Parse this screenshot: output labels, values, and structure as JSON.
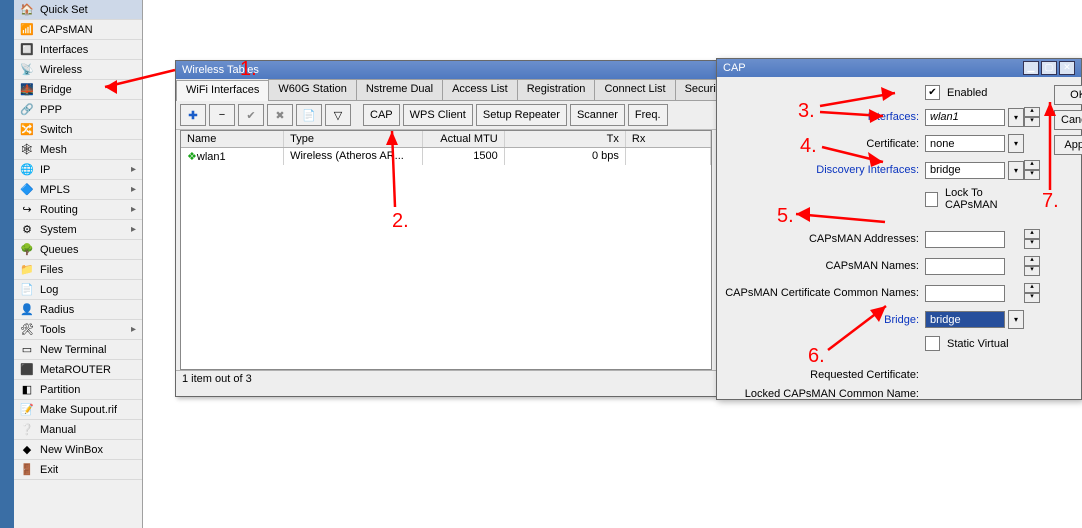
{
  "sidebar": {
    "items": [
      {
        "label": "Quick Set",
        "icon": "🏠",
        "hi": true
      },
      {
        "label": "CAPsMAN",
        "icon": "📶"
      },
      {
        "label": "Interfaces",
        "icon": "🔲"
      },
      {
        "label": "Wireless",
        "icon": "📡"
      },
      {
        "label": "Bridge",
        "icon": "🌉"
      },
      {
        "label": "PPP",
        "icon": "🔗"
      },
      {
        "label": "Switch",
        "icon": "🔀"
      },
      {
        "label": "Mesh",
        "icon": "🕸"
      },
      {
        "label": "IP",
        "icon": "🌐",
        "sub": true
      },
      {
        "label": "MPLS",
        "icon": "🔷",
        "sub": true
      },
      {
        "label": "Routing",
        "icon": "↪",
        "sub": true
      },
      {
        "label": "System",
        "icon": "⚙",
        "sub": true
      },
      {
        "label": "Queues",
        "icon": "🌳"
      },
      {
        "label": "Files",
        "icon": "📁"
      },
      {
        "label": "Log",
        "icon": "📄"
      },
      {
        "label": "Radius",
        "icon": "👤"
      },
      {
        "label": "Tools",
        "icon": "🛠",
        "sub": true
      },
      {
        "label": "New Terminal",
        "icon": "▭"
      },
      {
        "label": "MetaROUTER",
        "icon": "⬛"
      },
      {
        "label": "Partition",
        "icon": "◧"
      },
      {
        "label": "Make Supout.rif",
        "icon": "📝"
      },
      {
        "label": "Manual",
        "icon": "❔"
      },
      {
        "label": "New WinBox",
        "icon": "◆"
      },
      {
        "label": "Exit",
        "icon": "🚪"
      }
    ]
  },
  "wireless_window": {
    "title": "Wireless Tables",
    "tabs": [
      "WiFi Interfaces",
      "W60G Station",
      "Nstreme Dual",
      "Access List",
      "Registration",
      "Connect List",
      "Security Profiles"
    ],
    "active_tab": 0,
    "toolbar": {
      "cap": "CAP",
      "wps": "WPS Client",
      "setup": "Setup Repeater",
      "scanner": "Scanner",
      "freq": "Freq."
    },
    "columns": [
      "Name",
      "Type",
      "Actual MTU",
      "Tx",
      "Rx"
    ],
    "rows": [
      {
        "name": "wlan1",
        "type": "Wireless (Atheros AR...",
        "mtu": "1500",
        "tx": "0 bps",
        "rx": ""
      }
    ],
    "status": "1 item out of 3"
  },
  "cap_dialog": {
    "title": "CAP",
    "enabled_label": "Enabled",
    "enabled_checked": true,
    "fields": {
      "interfaces": {
        "label": "Interfaces:",
        "value": "wlan1",
        "link": true,
        "drop": true,
        "arrows": true
      },
      "certificate": {
        "label": "Certificate:",
        "value": "none",
        "drop": true
      },
      "discovery": {
        "label": "Discovery Interfaces:",
        "value": "bridge",
        "link": true,
        "drop": true,
        "arrows": true
      },
      "lock": {
        "label": "Lock To CAPsMAN",
        "check": false
      },
      "addresses": {
        "label": "CAPsMAN Addresses:",
        "value": "",
        "arrows": true
      },
      "names": {
        "label": "CAPsMAN Names:",
        "value": "",
        "arrows": true
      },
      "certnames": {
        "label": "CAPsMAN Certificate Common Names:",
        "value": "",
        "arrows": true
      },
      "bridge": {
        "label": "Bridge:",
        "value": "bridge",
        "link": true,
        "drop": true,
        "selected": true
      },
      "static": {
        "label": "Static Virtual",
        "check": false
      },
      "reqcert": {
        "label": "Requested Certificate:",
        "value": ""
      },
      "lockedname": {
        "label": "Locked CAPsMAN Common Name:",
        "value": ""
      }
    },
    "buttons": {
      "ok": "OK",
      "cancel": "Cancel",
      "apply": "Apply"
    }
  },
  "annotations": {
    "n1": "1.",
    "n2": "2.",
    "n3": "3.",
    "n4": "4.",
    "n5": "5.",
    "n6": "6.",
    "n7": "7."
  }
}
